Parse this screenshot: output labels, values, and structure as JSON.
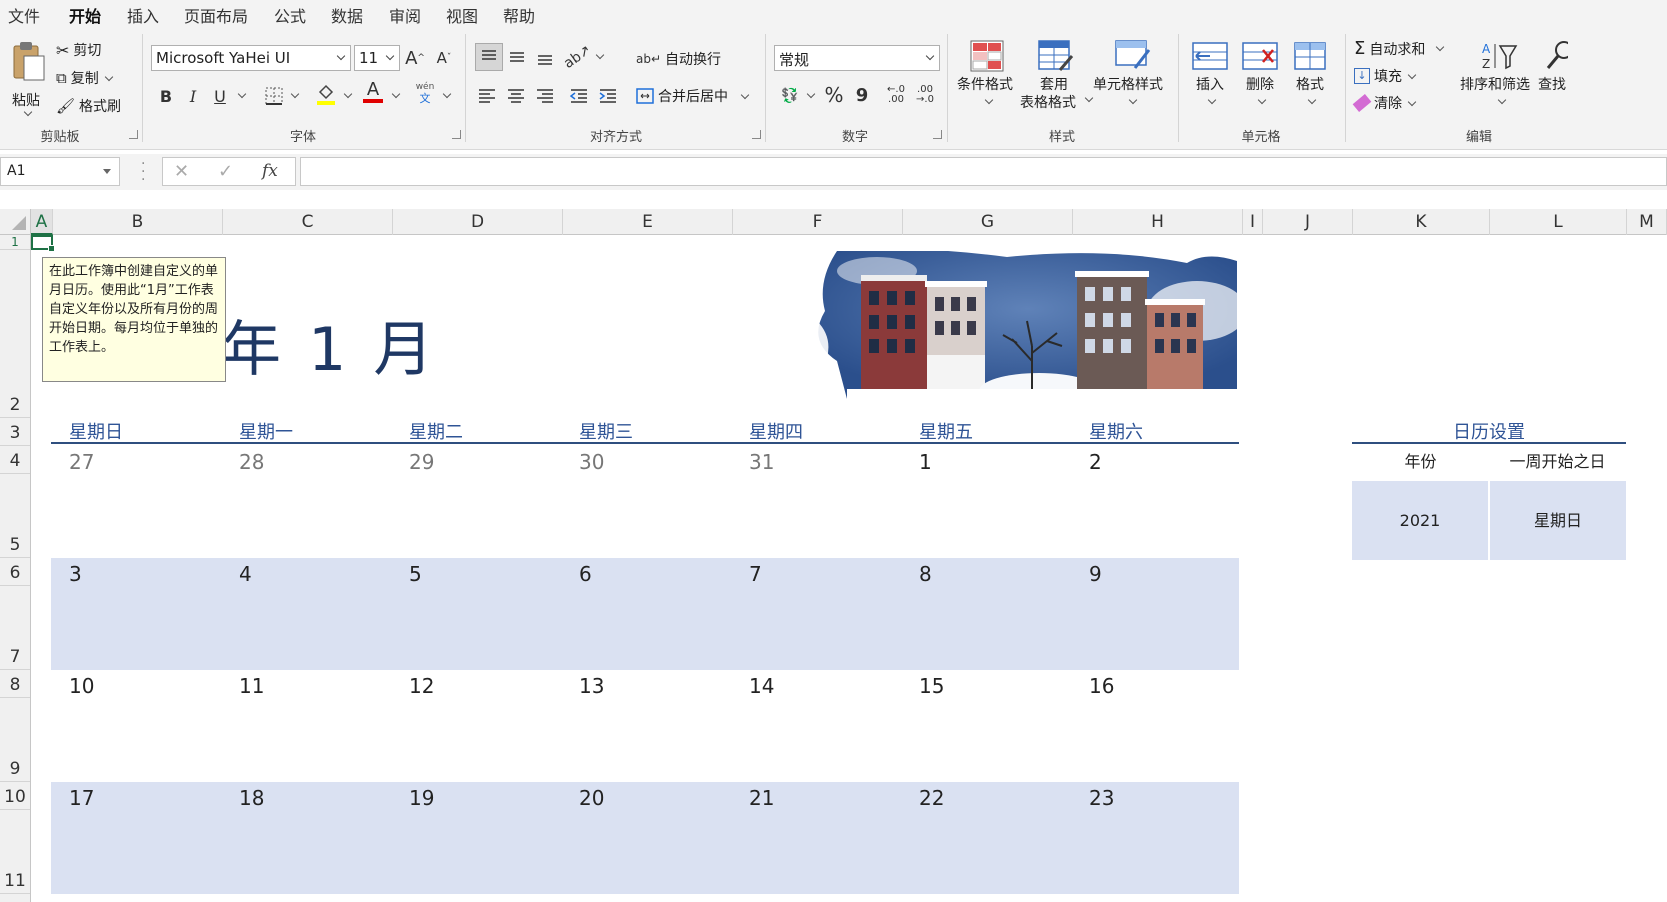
{
  "menu": {
    "tabs": [
      "文件",
      "开始",
      "插入",
      "页面布局",
      "公式",
      "数据",
      "审阅",
      "视图",
      "帮助"
    ],
    "active_index": 1
  },
  "ribbon": {
    "clipboard": {
      "paste": "粘贴",
      "cut": "剪切",
      "copy": "复制",
      "format_painter": "格式刷",
      "label": "剪贴板"
    },
    "font": {
      "name": "Microsoft YaHei UI",
      "size": "11",
      "bold": "B",
      "italic": "I",
      "underline": "U",
      "font_color": "A",
      "phonetic_top": "wén",
      "phonetic_bottom": "文",
      "grow": "A",
      "shrink": "A",
      "label": "字体"
    },
    "alignment": {
      "wrap": "自动换行",
      "merge": "合并后居中",
      "label": "对齐方式"
    },
    "number": {
      "format": "常规",
      "percent": "%",
      "comma": "9",
      "inc_decimal": "←.0\n.00",
      "dec_decimal": ".00\n→.0",
      "label": "数字"
    },
    "styles": {
      "conditional": "条件格式",
      "table_format_1": "套用",
      "table_format_2": "表格格式",
      "cell_styles": "单元格样式",
      "label": "样式"
    },
    "cells": {
      "insert": "插入",
      "delete": "删除",
      "format": "格式",
      "label": "单元格"
    },
    "editing": {
      "autosum": "自动求和",
      "fill": "填充",
      "clear": "清除",
      "sort_filter": "排序和筛选",
      "find": "查找",
      "label": "编辑"
    }
  },
  "formula_bar": {
    "name_box": "A1",
    "fx": "fx",
    "content": ""
  },
  "columns": [
    "A",
    "B",
    "C",
    "D",
    "E",
    "F",
    "G",
    "H",
    "I",
    "J",
    "K",
    "L",
    "M"
  ],
  "rows": [
    "1",
    "2",
    "3",
    "4",
    "5",
    "6",
    "7",
    "8",
    "9",
    "10",
    "11"
  ],
  "tooltip": "在此工作簿中创建自定义的单月日历。使用此“1月”工作表自定义年份以及所有月份的周开始日期。每月均位于单独的工作表上。",
  "calendar": {
    "title": "年 1 月",
    "weekdays": [
      "星期日",
      "星期一",
      "星期二",
      "星期三",
      "星期四",
      "星期五",
      "星期六"
    ],
    "weeks": [
      [
        "27",
        "28",
        "29",
        "30",
        "31",
        "1",
        "2"
      ],
      [
        "3",
        "4",
        "5",
        "6",
        "7",
        "8",
        "9"
      ],
      [
        "10",
        "11",
        "12",
        "13",
        "14",
        "15",
        "16"
      ],
      [
        "17",
        "18",
        "19",
        "20",
        "21",
        "22",
        "23"
      ]
    ]
  },
  "settings": {
    "title": "日历设置",
    "year_label": "年份",
    "week_start_label": "一周开始之日",
    "year_value": "2021",
    "week_start_value": "星期日"
  },
  "colors": {
    "accent": "#1e7145",
    "title": "#1f3864",
    "header_blue": "#2f5496",
    "shade": "#dae1f2"
  }
}
